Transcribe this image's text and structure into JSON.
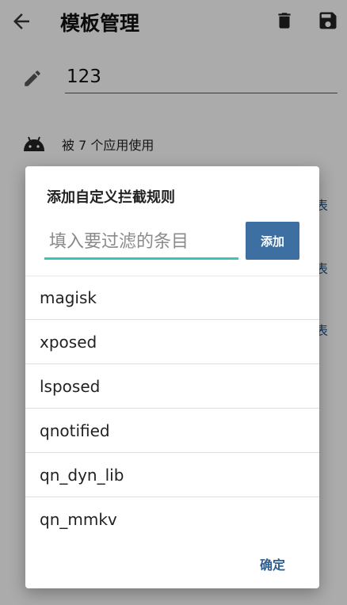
{
  "appbar": {
    "title": "模板管理",
    "back_icon": "arrow-left-icon",
    "delete_icon": "trash-icon",
    "save_icon": "floppy-disk-icon"
  },
  "template": {
    "name_value": "123",
    "usage_text": "被 7 个应用使用"
  },
  "background_peek": [
    "表",
    "表",
    "表"
  ],
  "dialog": {
    "title": "添加自定义拦截规则",
    "input_placeholder": "填入要过滤的条目",
    "add_label": "添加",
    "items": [
      "magisk",
      "xposed",
      "lsposed",
      "qnotified",
      "qn_dyn_lib",
      "qn_mmkv"
    ],
    "confirm_label": "确定"
  },
  "colors": {
    "accent": "#3cc4b8",
    "button": "#3d6fa3",
    "confirm_text": "#2d5f95"
  }
}
